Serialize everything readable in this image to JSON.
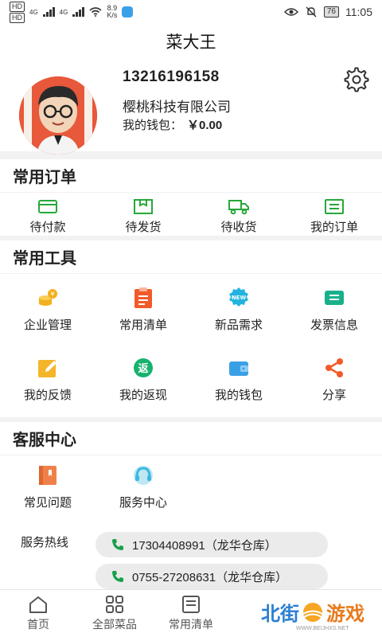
{
  "status_bar": {
    "sim1": "HD",
    "sim2": "HD",
    "net1": "4G",
    "net2": "4G",
    "speed_value": "8.9",
    "speed_unit": "K/s",
    "battery": "76",
    "time": "11:05"
  },
  "title": "菜大王",
  "profile": {
    "phone": "13216196158",
    "company": "樱桃科技有限公司",
    "wallet_label": "我的钱包：",
    "wallet_amount": "￥0.00"
  },
  "orders": {
    "title": "常用订单",
    "items": [
      {
        "label": "待付款",
        "icon": "wallet-card-icon"
      },
      {
        "label": "待发货",
        "icon": "box-icon"
      },
      {
        "label": "待收货",
        "icon": "truck-icon"
      },
      {
        "label": "我的订单",
        "icon": "receipt-icon"
      }
    ]
  },
  "tools": {
    "title": "常用工具",
    "items": [
      {
        "label": "企业管理",
        "icon": "coins-icon"
      },
      {
        "label": "常用清单",
        "icon": "clipboard-icon"
      },
      {
        "label": "新品需求",
        "icon": "new-badge-icon"
      },
      {
        "label": "发票信息",
        "icon": "invoice-icon"
      },
      {
        "label": "我的反馈",
        "icon": "edit-icon"
      },
      {
        "label": "我的返现",
        "icon": "cashback-icon"
      },
      {
        "label": "我的钱包",
        "icon": "wallet-icon"
      },
      {
        "label": "分享",
        "icon": "share-icon"
      }
    ]
  },
  "service": {
    "title": "客服中心",
    "items": [
      {
        "label": "常见问题",
        "icon": "faq-book-icon"
      },
      {
        "label": "服务中心",
        "icon": "headset-icon"
      }
    ],
    "hotline_label": "服务热线",
    "hotlines": [
      "17304408991（龙华仓库）",
      "0755-27208631（龙华仓库）"
    ]
  },
  "tabbar": {
    "items": [
      {
        "label": "首页",
        "icon": "home-icon"
      },
      {
        "label": "全部菜品",
        "icon": "grid-icon"
      },
      {
        "label": "常用清单",
        "icon": "list-icon"
      }
    ]
  },
  "watermark": {
    "text_a": "北街",
    "text_b": "游戏",
    "sub": "WWW.BEIJHXS.NET"
  },
  "colors": {
    "order_icon": "#27a839",
    "coins": "#f2b01e",
    "clipboard": "#f25a2a",
    "new_badge": "#23b3e0",
    "invoice": "#18b08a",
    "edit": "#f5b52a",
    "cashback": "#17b26d",
    "wallet": "#3aa0e6",
    "share": "#f25a2a",
    "faq": "#f0804a",
    "headset": "#3cb8e0"
  }
}
